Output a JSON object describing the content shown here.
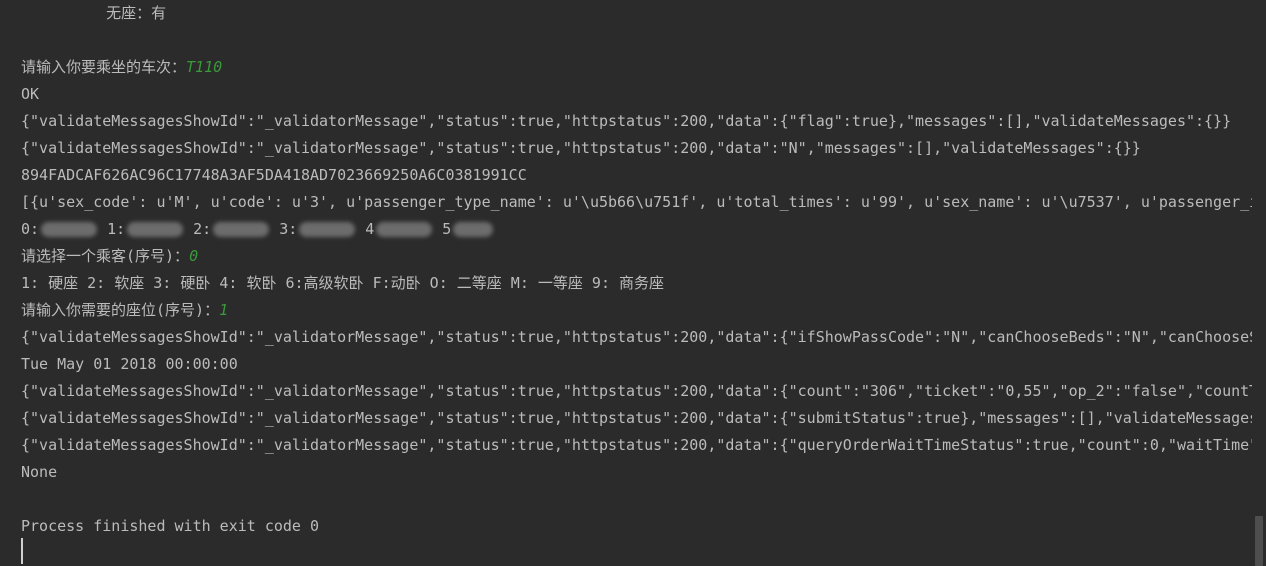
{
  "console": {
    "line_wuzuo": "    无座：有",
    "prompt_train": "请输入你要乘坐的车次：",
    "input_train": "T110",
    "ok": "OK",
    "resp_flag": "{\"validateMessagesShowId\":\"_validatorMessage\",\"status\":true,\"httpstatus\":200,\"data\":{\"flag\":true},\"messages\":[],\"validateMessages\":{}}",
    "resp_n": "{\"validateMessagesShowId\":\"_validatorMessage\",\"status\":true,\"httpstatus\":200,\"data\":\"N\",\"messages\":[],\"validateMessages\":{}}",
    "hash": "894FADCAF626AC96C17748A3AF5DA418AD7023669250A6C0381991CC",
    "passengers_dict": "[{u'sex_code': u'M', u'code': u'3', u'passenger_type_name': u'\\u5b66\\u751f', u'total_times': u'99', u'sex_name': u'\\u7537', u'passenger_id",
    "passenger_labels": [
      "0:",
      "1:",
      "2:",
      "3:",
      "4",
      "5"
    ],
    "prompt_passenger": "请选择一个乘客(序号)：",
    "input_passenger": "0",
    "seat_types": "1: 硬座 2: 软座 3: 硬卧 4: 软卧 6:高级软卧 F:动卧 O: 二等座 M: 一等座 9: 商务座",
    "prompt_seat": "请输入你需要的座位(序号)：",
    "input_seat": "1",
    "resp_passcode": "{\"validateMessagesShowId\":\"_validatorMessage\",\"status\":true,\"httpstatus\":200,\"data\":{\"ifShowPassCode\":\"N\",\"canChooseBeds\":\"N\",\"canChooseSe",
    "date": "Tue May 01 2018 00:00:00",
    "resp_count": "{\"validateMessagesShowId\":\"_validatorMessage\",\"status\":true,\"httpstatus\":200,\"data\":{\"count\":\"306\",\"ticket\":\"0,55\",\"op_2\":\"false\",\"countT",
    "resp_submit": "{\"validateMessagesShowId\":\"_validatorMessage\",\"status\":true,\"httpstatus\":200,\"data\":{\"submitStatus\":true},\"messages\":[],\"validateMessages",
    "resp_wait": "{\"validateMessagesShowId\":\"_validatorMessage\",\"status\":true,\"httpstatus\":200,\"data\":{\"queryOrderWaitTimeStatus\":true,\"count\":0,\"waitTime\":",
    "none": "None",
    "exit": "Process finished with exit code 0"
  },
  "colors": {
    "background": "#2b2b2b",
    "text": "#bbbbbb",
    "user_input": "#3a9a3a"
  }
}
